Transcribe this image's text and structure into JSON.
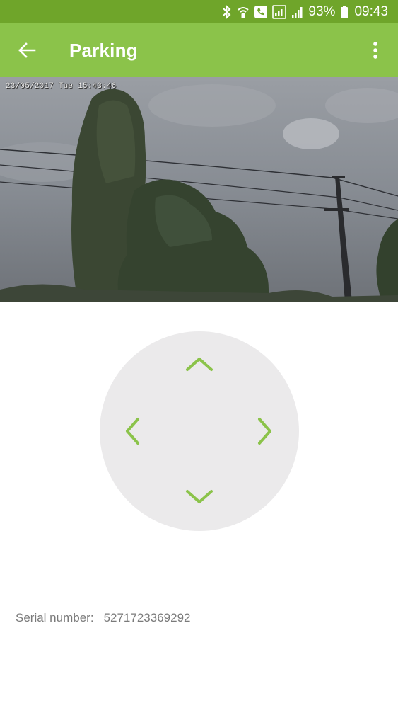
{
  "status_bar": {
    "battery_percent": "93%",
    "time": "09:43",
    "icons": [
      "bluetooth-icon",
      "wifi-calling-icon",
      "phone-icon",
      "signal-sim1-icon",
      "signal-sim2-icon",
      "battery-icon"
    ]
  },
  "app_bar": {
    "title": "Parking",
    "back_icon": "arrow-left-icon",
    "menu_icon": "more-vertical-icon"
  },
  "camera": {
    "timestamp": "23/05/2017 Tue 15:43:46"
  },
  "joystick": {
    "directions": [
      "up",
      "down",
      "left",
      "right"
    ],
    "arrow_color": "#8bc34a",
    "pad_color": "#ebeaeb"
  },
  "device": {
    "serial_label": "Serial number:",
    "serial_value": "5271723369292"
  },
  "colors": {
    "status_bar": "#6fa52a",
    "app_bar": "#8bc34a",
    "accent": "#8bc34a"
  }
}
